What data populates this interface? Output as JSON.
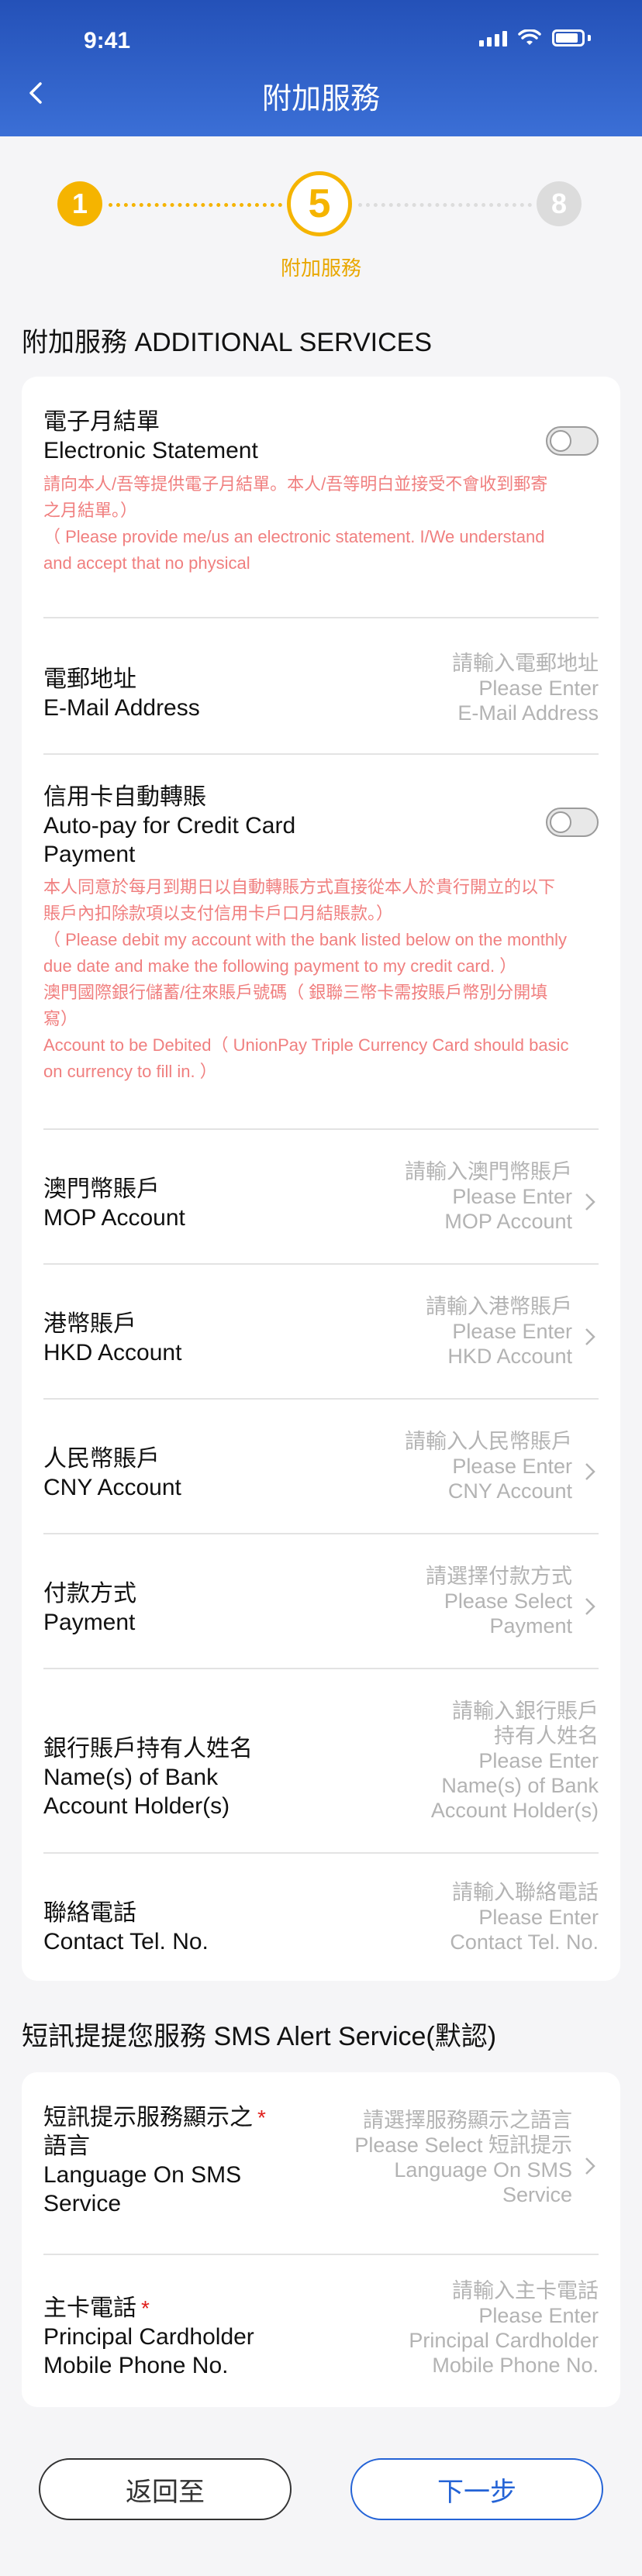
{
  "status": {
    "time": "9:41"
  },
  "header": {
    "title": "附加服務"
  },
  "stepper": {
    "steps": [
      "1",
      "5",
      "8"
    ],
    "current_label": "附加服務"
  },
  "section_additional": {
    "title": "附加服務 ADDITIONAL SERVICES"
  },
  "e_statement": {
    "label_zh": "電子月結單",
    "label_en": "Electronic Statement",
    "enabled": false,
    "notice_line1": "請向本人/吾等提供電子月結單。本人/吾等明白並接受不會收到郵寄",
    "notice_line2": "之月結單。）",
    "notice_line3": "（ Please provide me/us an electronic statement. I/We understand",
    "notice_line4": "and accept that no physical"
  },
  "email": {
    "label_zh": "電郵地址",
    "label_en": "E-Mail Address",
    "ph_zh": "請輸入電郵地址",
    "ph_en1": "Please Enter",
    "ph_en2": "E-Mail Address"
  },
  "autopay": {
    "label_zh": "信用卡自動轉賬",
    "label_en1": "Auto-pay for Credit Card",
    "label_en2": "Payment",
    "enabled": false,
    "notice_line1": "本人同意於每月到期日以自動轉賬方式直接從本人於貴行開立的以下",
    "notice_line2": "賬戶內扣除款項以支付信用卡戶口月結賬款。）",
    "notice_line3": "（ Please debit my account with the bank listed below on the monthly",
    "notice_line4": "due date and make the following payment to my credit card. ）",
    "notice_line5": "澳門國際銀行儲蓄/往來賬戶號碼（ 銀聯三幣卡需按賬戶幣別分開填",
    "notice_line6": "寫）",
    "notice_line7": "Account to be Debited（ UnionPay Triple Currency Card should basic",
    "notice_line8": "on currency to fill in. ）"
  },
  "mop": {
    "label_zh": "澳門幣賬戶",
    "label_en": "MOP Account",
    "ph_zh": "請輸入澳門幣賬戶",
    "ph_en1": "Please Enter",
    "ph_en2": "MOP Account"
  },
  "hkd": {
    "label_zh": "港幣賬戶",
    "label_en": "HKD Account",
    "ph_zh": "請輸入港幣賬戶",
    "ph_en1": "Please Enter",
    "ph_en2": "HKD Account"
  },
  "cny": {
    "label_zh": "人民幣賬戶",
    "label_en": "CNY Account",
    "ph_zh": "請輸入人民幣賬戶",
    "ph_en1": "Please Enter",
    "ph_en2": "CNY Account"
  },
  "payment": {
    "label_zh": "付款方式",
    "label_en": "Payment",
    "ph_zh": "請選擇付款方式",
    "ph_en1": "Please Select",
    "ph_en2": "Payment"
  },
  "holder": {
    "label_zh": "銀行賬戶持有人姓名",
    "label_en1": "Name(s) of Bank",
    "label_en2": "Account Holder(s)",
    "ph_zh1": "請輸入銀行賬戶",
    "ph_zh2": "持有人姓名",
    "ph_en1": "Please Enter",
    "ph_en2": "Name(s) of Bank",
    "ph_en3": "Account Holder(s)"
  },
  "contact": {
    "label_zh": "聯絡電話",
    "label_en": "Contact Tel. No.",
    "ph_zh": "請輸入聯絡電話",
    "ph_en1": "Please Enter",
    "ph_en2": "Contact Tel. No."
  },
  "section_sms": {
    "title": "短訊提提您服務 SMS Alert Service(默認)"
  },
  "sms_lang": {
    "label_zh1": "短訊提示服務顯示之",
    "required_mark": "*",
    "label_zh2": "語言",
    "label_en1": "Language On SMS",
    "label_en2": "Service",
    "ph_zh": "請選擇服務顯示之語言",
    "ph_en1": "Please Select 短訊提示",
    "ph_en2": "Language On SMS",
    "ph_en3": "Service"
  },
  "principal_phone": {
    "label_zh": "主卡電話",
    "required_mark": "*",
    "label_en1": "Principal Cardholder",
    "label_en2": "Mobile Phone No.",
    "ph_zh": "請輸入主卡電話",
    "ph_en1": "Please Enter",
    "ph_en2": "Principal Cardholder",
    "ph_en3": "Mobile Phone No."
  },
  "buttons": {
    "back": "返回至",
    "next": "下一步"
  },
  "colors": {
    "brand_blue": "#2451b8",
    "accent_yellow": "#f5b400",
    "notice_red": "#f07f7f",
    "next_blue": "#2463d6"
  }
}
